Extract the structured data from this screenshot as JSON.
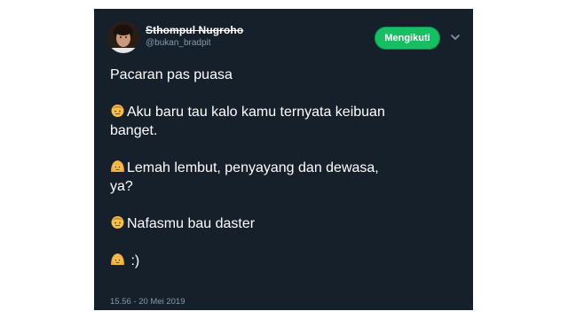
{
  "author": {
    "display_name": "Sthompul Nugroho",
    "handle": "@bukan_bradpit"
  },
  "actions": {
    "follow_label": "Mengikuti",
    "menu_icon": "chevron-down-icon"
  },
  "tweet": {
    "title_line": "Pacaran pas puasa",
    "p1_l1": "Aku baru tau kalo kamu ternyata keibuan",
    "p1_l2": "banget.",
    "p2_l1": "Lemah lembut, penyayang dan dewasa,",
    "p2_l2": "ya?",
    "p3_l1": "Nafasmu bau daster",
    "p4_l1": ":)",
    "emoji_man": "man-face-emoji",
    "emoji_woman": "woman-face-emoji"
  },
  "meta": {
    "timestamp": "15.56 - 20 Mei 2019"
  },
  "colors": {
    "card_bg": "#15202b",
    "follow_green": "#17bf63",
    "muted_text": "#8899a6"
  }
}
